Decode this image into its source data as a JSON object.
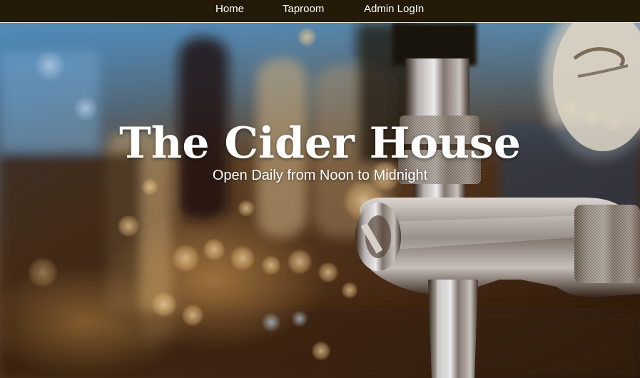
{
  "nav": {
    "items": [
      {
        "label": "Home"
      },
      {
        "label": "Taproom"
      },
      {
        "label": "Admin LogIn"
      }
    ],
    "background": "#231a07"
  },
  "hero": {
    "title": "The Cider House",
    "subtitle": "Open Daily from Noon to Midnight",
    "image_alt": "blurred bar with chrome beer tap in foreground"
  }
}
